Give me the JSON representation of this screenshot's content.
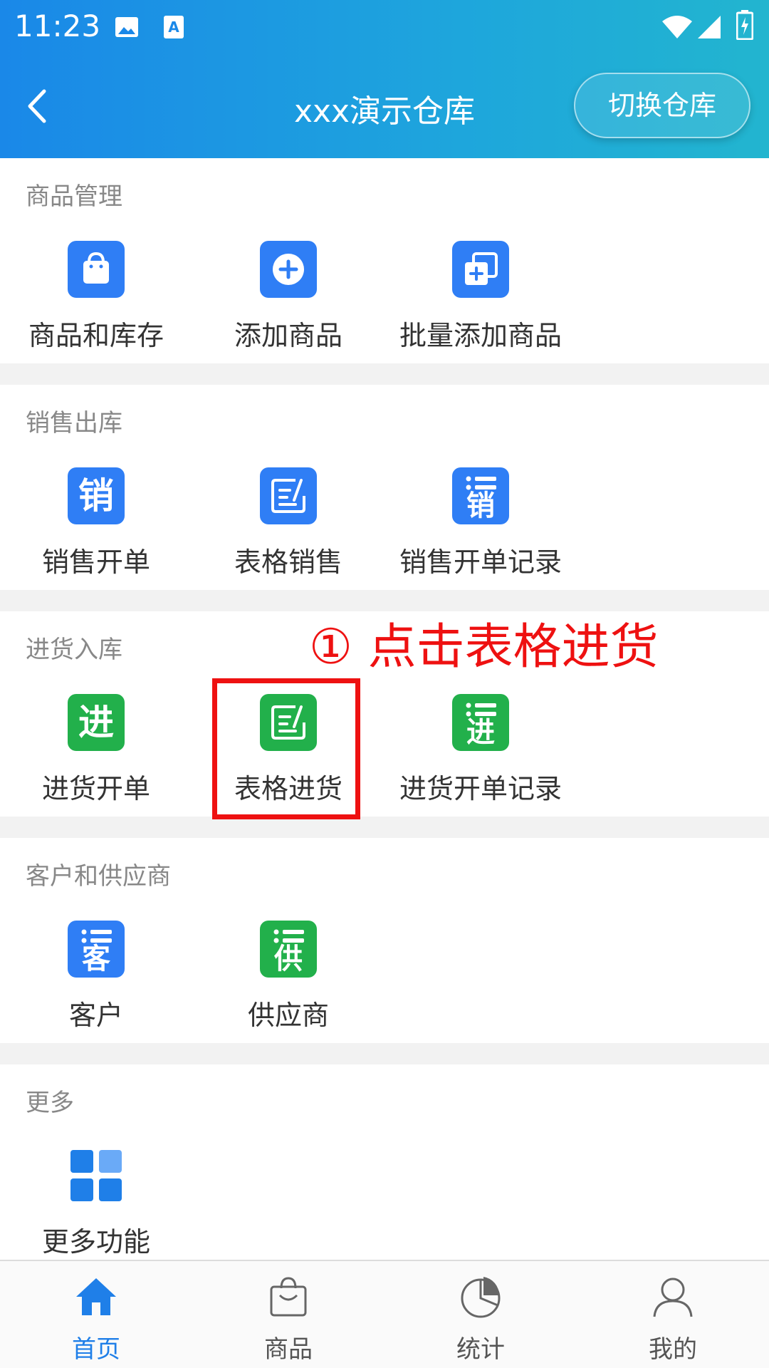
{
  "status_bar": {
    "time": "11:23"
  },
  "header": {
    "title": "xxx演示仓库",
    "switch_label": "切换仓库"
  },
  "sections": [
    {
      "title": "商品管理",
      "items": [
        {
          "label": "商品和库存",
          "icon": "shopping-bag-icon"
        },
        {
          "label": "添加商品",
          "icon": "add-circle-icon"
        },
        {
          "label": "批量添加商品",
          "icon": "batch-add-icon"
        }
      ]
    },
    {
      "title": "销售出库",
      "items": [
        {
          "label": "销售开单",
          "icon": "sales-order-icon",
          "glyph": "销"
        },
        {
          "label": "表格销售",
          "icon": "table-edit-icon"
        },
        {
          "label": "销售开单记录",
          "icon": "sales-record-icon",
          "glyph": "销"
        }
      ]
    },
    {
      "title": "进货入库",
      "items": [
        {
          "label": "进货开单",
          "icon": "purchase-order-icon",
          "glyph": "进"
        },
        {
          "label": "表格进货",
          "icon": "table-edit-icon"
        },
        {
          "label": "进货开单记录",
          "icon": "purchase-record-icon",
          "glyph": "进"
        }
      ]
    },
    {
      "title": "客户和供应商",
      "items": [
        {
          "label": "客户",
          "icon": "customer-icon",
          "glyph": "客"
        },
        {
          "label": "供应商",
          "icon": "supplier-icon",
          "glyph": "供"
        }
      ]
    },
    {
      "title": "更多",
      "items": [
        {
          "label": "更多功能",
          "icon": "grid-icon"
        }
      ]
    }
  ],
  "annotation": {
    "text": "① 点击表格进货"
  },
  "bottom_nav": [
    {
      "label": "首页",
      "icon": "home-icon",
      "active": true
    },
    {
      "label": "商品",
      "icon": "bag-icon"
    },
    {
      "label": "统计",
      "icon": "pie-chart-icon"
    },
    {
      "label": "我的",
      "icon": "user-icon"
    }
  ],
  "colors": {
    "accent": "#1f7fe8",
    "blue_icon": "#2f7ef5",
    "green_icon": "#22b04b",
    "annotation": "#ee1111"
  }
}
